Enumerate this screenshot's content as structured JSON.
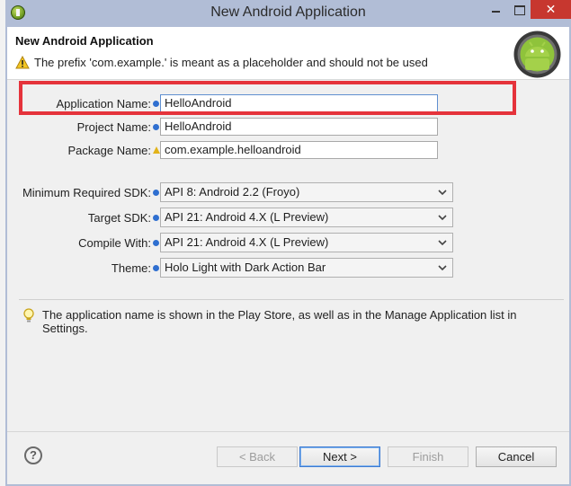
{
  "window": {
    "title": "New Android Application"
  },
  "header": {
    "title": "New Android Application",
    "message": "The prefix 'com.example.' is meant as a placeholder and should not be used"
  },
  "fields": {
    "app_name_label": "Application Name:",
    "app_name_value": "HelloAndroid",
    "project_name_label": "Project Name:",
    "project_name_value": "HelloAndroid",
    "package_name_label": "Package Name:",
    "package_name_value": "com.example.helloandroid"
  },
  "selects": {
    "min_sdk_label": "Minimum Required SDK:",
    "min_sdk_value": "API 8: Android 2.2 (Froyo)",
    "target_sdk_label": "Target SDK:",
    "target_sdk_value": "API 21: Android 4.X (L Preview)",
    "compile_with_label": "Compile With:",
    "compile_with_value": "API 21: Android 4.X (L Preview)",
    "theme_label": "Theme:",
    "theme_value": "Holo Light with Dark Action Bar"
  },
  "hint": {
    "text": "The application name is shown in the Play Store, as well as in the Manage Application list in Settings."
  },
  "buttons": {
    "help": "?",
    "back": "< Back",
    "next": "Next >",
    "finish": "Finish",
    "cancel": "Cancel"
  },
  "colors": {
    "highlight_box": "#e5333b",
    "close_button": "#c7372f",
    "info_icon": "#2f6fd0"
  },
  "icons": [
    "app-icon",
    "warning-icon",
    "info-icon",
    "warning-small-icon",
    "chevron-down-icon",
    "lightbulb-icon",
    "help-icon",
    "android-logo"
  ]
}
